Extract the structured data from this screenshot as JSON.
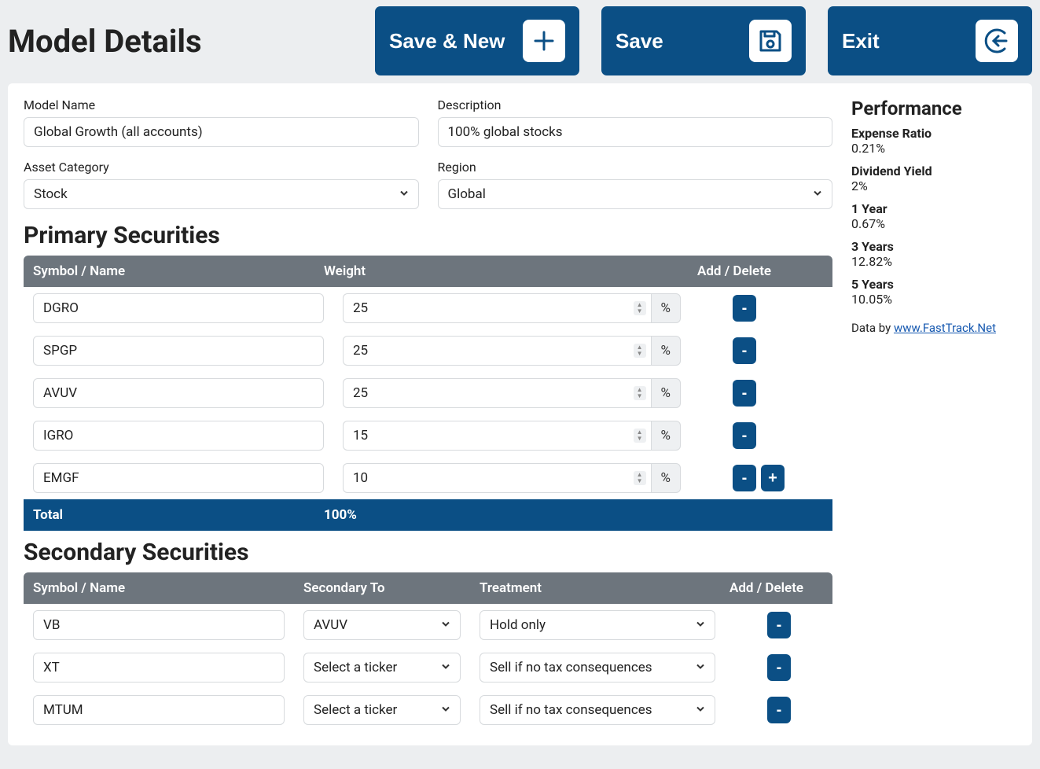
{
  "header": {
    "title": "Model Details",
    "buttons": {
      "save_new": "Save & New",
      "save": "Save",
      "exit": "Exit"
    }
  },
  "form": {
    "model_name_label": "Model Name",
    "model_name_value": "Global Growth (all accounts)",
    "description_label": "Description",
    "description_value": "100% global stocks",
    "asset_category_label": "Asset Category",
    "asset_category_value": "Stock",
    "region_label": "Region",
    "region_value": "Global"
  },
  "primary": {
    "title": "Primary Securities",
    "headers": {
      "symbol": "Symbol / Name",
      "weight": "Weight",
      "action": "Add / Delete"
    },
    "percent_sign": "%",
    "rows": [
      {
        "symbol": "DGRO",
        "weight": "25"
      },
      {
        "symbol": "SPGP",
        "weight": "25"
      },
      {
        "symbol": "AVUV",
        "weight": "25"
      },
      {
        "symbol": "IGRO",
        "weight": "15"
      },
      {
        "symbol": "EMGF",
        "weight": "10"
      }
    ],
    "total_label": "Total",
    "total_value": "100%",
    "minus": "-",
    "plus": "+"
  },
  "secondary": {
    "title": "Secondary Securities",
    "headers": {
      "symbol": "Symbol / Name",
      "secondary_to": "Secondary To",
      "treatment": "Treatment",
      "action": "Add / Delete"
    },
    "rows": [
      {
        "symbol": "VB",
        "secondary_to": "AVUV",
        "treatment": "Hold only"
      },
      {
        "symbol": "XT",
        "secondary_to": "Select a ticker",
        "treatment": "Sell if no tax consequences"
      },
      {
        "symbol": "MTUM",
        "secondary_to": "Select a ticker",
        "treatment": "Sell if no tax consequences"
      }
    ],
    "minus": "-"
  },
  "performance": {
    "title": "Performance",
    "items": [
      {
        "label": "Expense Ratio",
        "value": "0.21%"
      },
      {
        "label": "Dividend Yield",
        "value": "2%"
      },
      {
        "label": "1 Year",
        "value": "0.67%"
      },
      {
        "label": "3 Years",
        "value": "12.82%"
      },
      {
        "label": "5 Years",
        "value": "10.05%"
      }
    ],
    "data_by_prefix": "Data by ",
    "data_by_link": "www.FastTrack.Net"
  }
}
